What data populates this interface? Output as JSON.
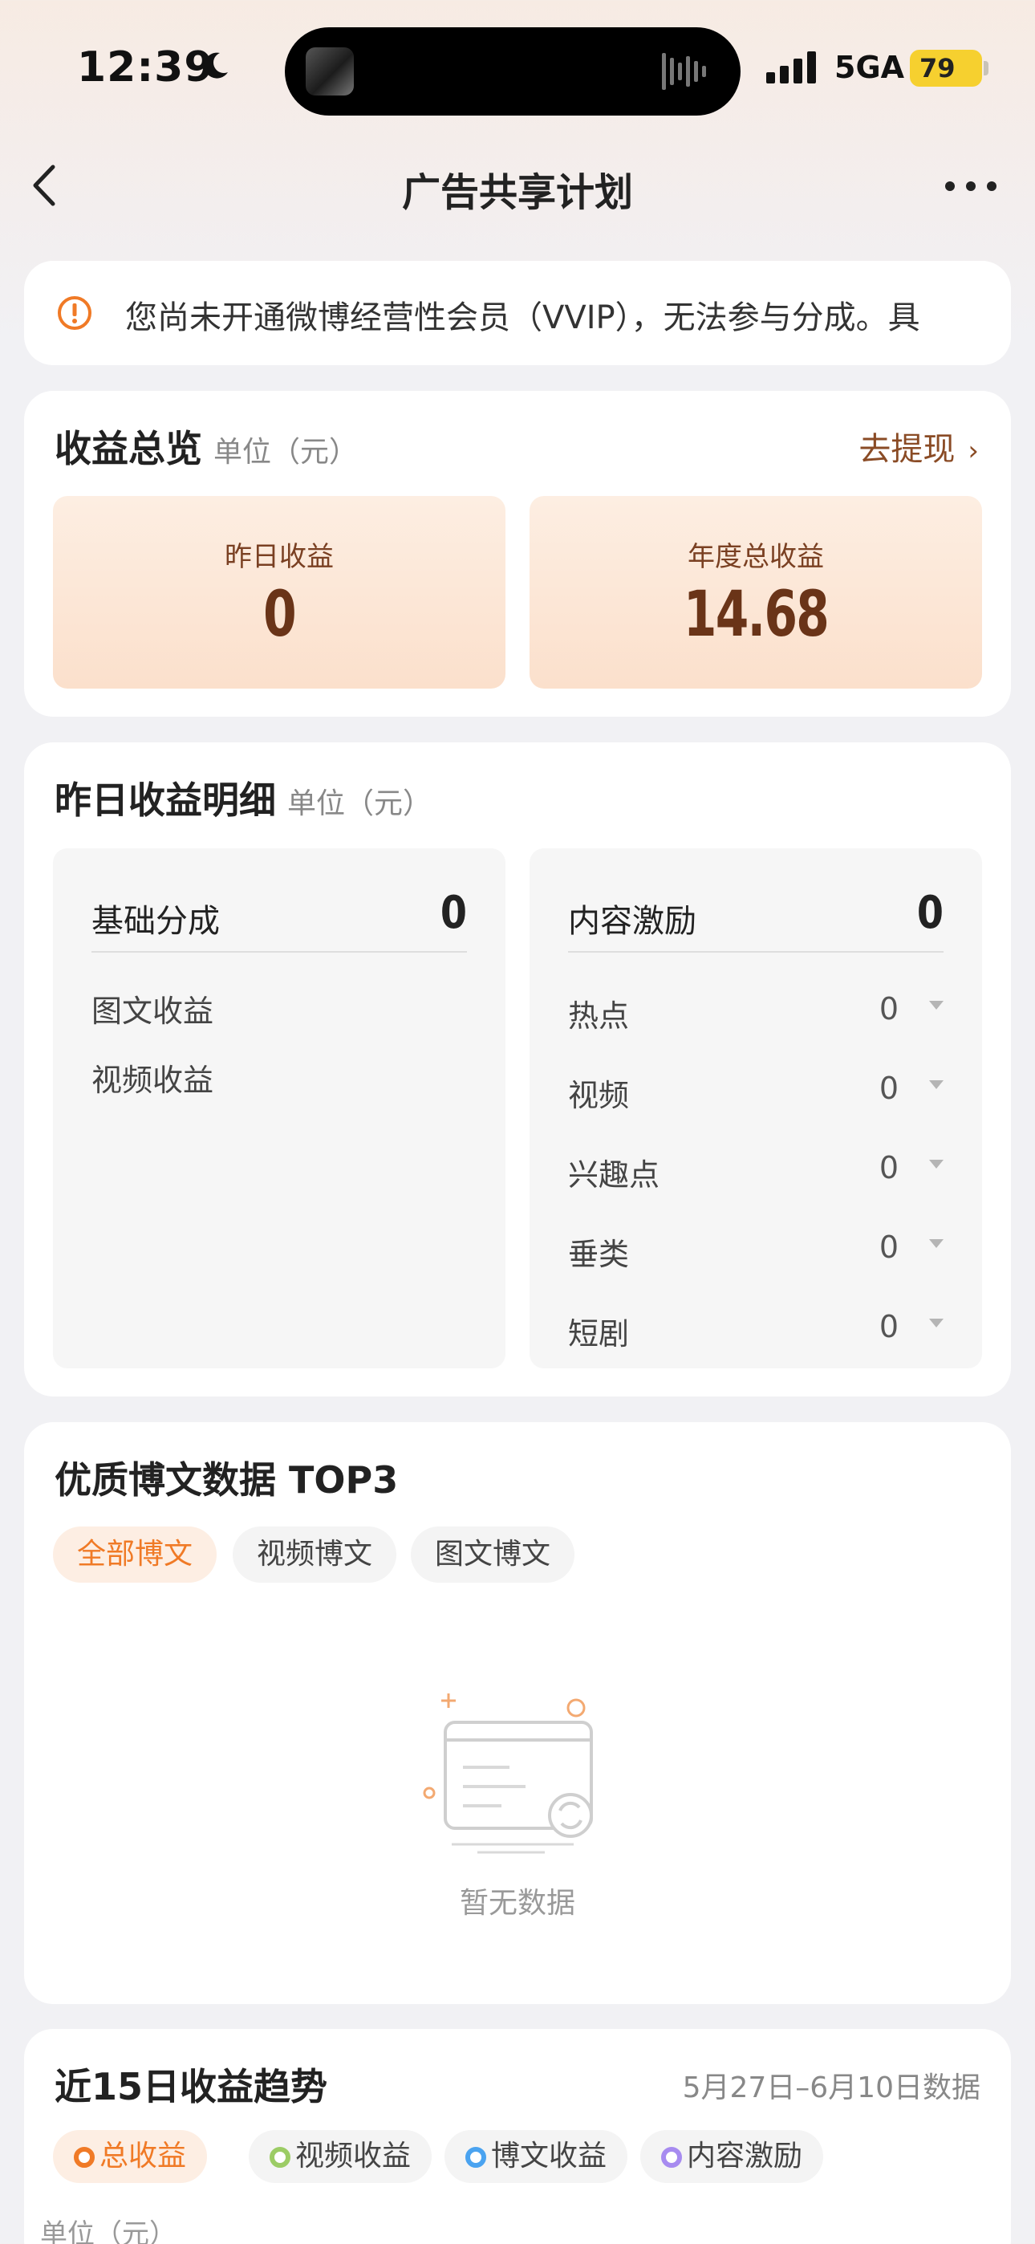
{
  "status_bar": {
    "time": "12:39",
    "network": "5GA",
    "battery": "79"
  },
  "nav": {
    "title": "广告共享计划"
  },
  "notice": {
    "text": "您尚未开通微博经营性会员（VVIP），无法参与分成。具"
  },
  "overview": {
    "title": "收益总览",
    "unit": "单位（元）",
    "withdraw_label": "去提现",
    "yesterday_label": "昨日收益",
    "yesterday_value": "0",
    "annual_label": "年度总收益",
    "annual_value": "14.68"
  },
  "detail": {
    "title": "昨日收益明细",
    "unit": "单位（元）",
    "base": {
      "label": "基础分成",
      "value": "0",
      "items": [
        "图文收益",
        "视频收益"
      ]
    },
    "content": {
      "label": "内容激励",
      "value": "0",
      "items": [
        {
          "label": "热点",
          "value": "0"
        },
        {
          "label": "视频",
          "value": "0"
        },
        {
          "label": "兴趣点",
          "value": "0"
        },
        {
          "label": "垂类",
          "value": "0"
        },
        {
          "label": "短剧",
          "value": "0"
        }
      ]
    }
  },
  "top3": {
    "title": "优质博文数据 TOP3",
    "tabs": [
      "全部博文",
      "视频博文",
      "图文博文"
    ],
    "empty_text": "暂无数据"
  },
  "trend": {
    "title": "近15日收益趋势",
    "date_range": "5月27日–6月10日数据",
    "legend": [
      {
        "label": "总收益",
        "color": "#f07a26"
      },
      {
        "label": "视频收益",
        "color": "#9ccc65"
      },
      {
        "label": "博文收益",
        "color": "#4aa3f0"
      },
      {
        "label": "内容激励",
        "color": "#a78bf0"
      }
    ],
    "unit": "单位（元）"
  },
  "colors": {
    "accent": "#f07a26",
    "brown": "#8a4b25"
  }
}
